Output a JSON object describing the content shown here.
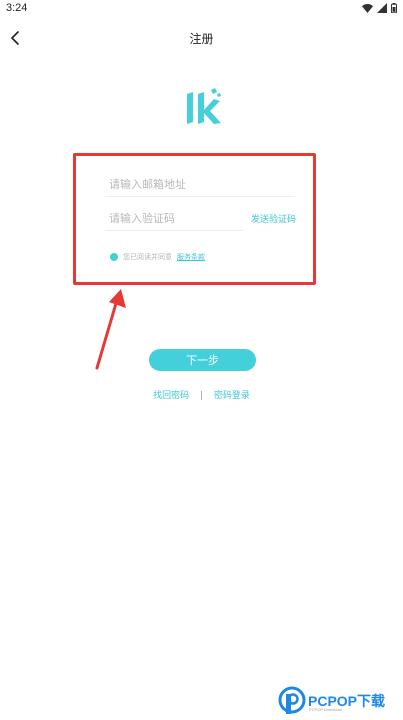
{
  "status_bar": {
    "time": "3:24",
    "icons": [
      "wifi-icon",
      "signal-icon",
      "battery-icon"
    ]
  },
  "nav": {
    "title": "注册",
    "back_icon": "chevron-left-icon"
  },
  "logo": {
    "icon": "app-logo-icon",
    "color": "#43d0da"
  },
  "form": {
    "email_placeholder": "请输入邮箱地址",
    "code_placeholder": "请输入验证码",
    "send_code_label": "发送验证码",
    "agree_prefix": "您已阅读并同意",
    "agree_link": "服务条款"
  },
  "actions": {
    "next_label": "下一步",
    "find_password_label": "找回密码",
    "separator": "|",
    "password_login_label": "密码登录"
  },
  "colors": {
    "accent": "#43d0da",
    "annotation": "#e53935",
    "watermark": "#1e88e5"
  },
  "watermark": {
    "text": "PCPOP下载",
    "sub": "PCPOP Download"
  }
}
